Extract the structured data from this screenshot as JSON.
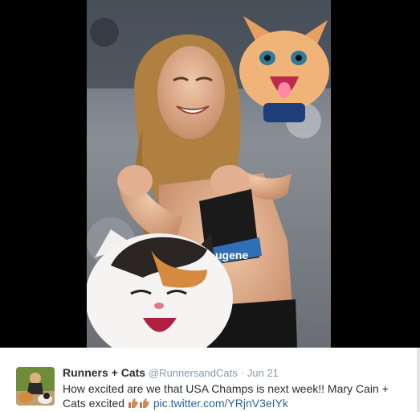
{
  "media": {
    "photo_icon": "runner-with-cats-photo",
    "bib_text": "ugene"
  },
  "tweet": {
    "avatar_icon": "runners-and-cats-avatar",
    "name": "Runners + Cats",
    "handle": "@RunnersandCats",
    "separator": "·",
    "date": "Jun 21",
    "text_main": "How excited are we that USA Champs is next week!! Mary Cain + Cats excited",
    "emoji_icon": "thumbs-up-emoji",
    "link": "pic.twitter.com/YRjnV3eIYk"
  },
  "colors": {
    "name": "#292f33",
    "meta": "#8899a6",
    "link": "#2a6496",
    "background": "#000000"
  }
}
